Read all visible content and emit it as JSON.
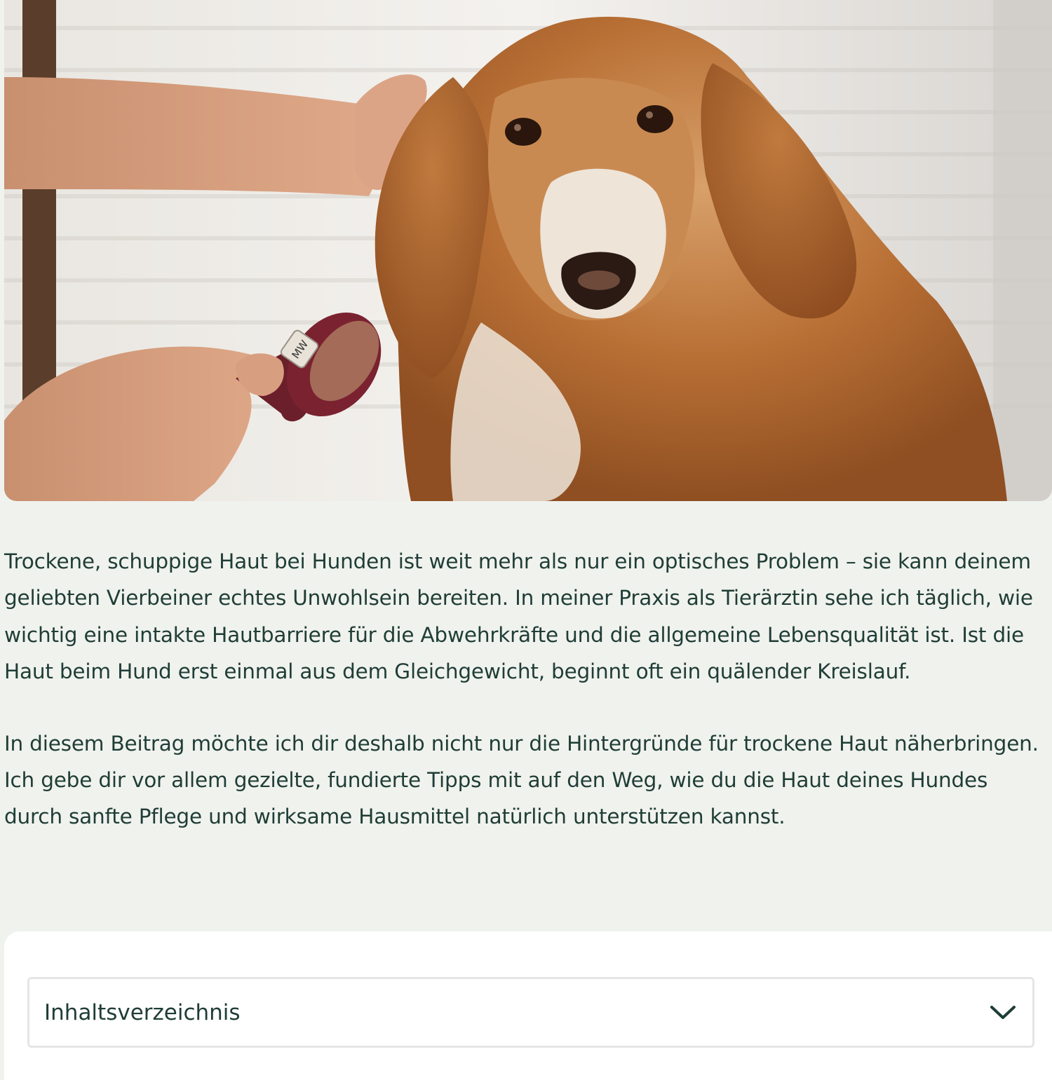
{
  "hero": {
    "brush_label": "MW"
  },
  "article": {
    "paragraphs": [
      "Trockene, schuppige Haut bei Hunden ist weit mehr als nur ein optisches Problem – sie kann deinem geliebten Vierbeiner echtes Unwohlsein bereiten. In meiner Praxis als Tierärztin sehe ich täglich, wie wichtig eine intakte Hautbarriere für die Abwehrkräfte und die allgemeine Lebensqualität ist. Ist die Haut beim Hund erst einmal aus dem Gleichgewicht, beginnt oft ein quälender Kreislauf.",
      "In diesem Beitrag möchte ich dir deshalb nicht nur die Hintergründe für trockene Haut näherbringen. Ich gebe dir vor allem gezielte, fundierte Tipps mit auf den Weg, wie du die Haut deines Hundes durch sanfte Pflege und wirksame Hausmittel natürlich unterstützen kannst."
    ]
  },
  "toc": {
    "label": "Inhaltsverzeichnis",
    "icon": "chevron-down-icon"
  },
  "colors": {
    "background": "#f0f2ee",
    "text": "#1f3d36",
    "card": "#ffffff",
    "border": "#e4e6e3"
  }
}
